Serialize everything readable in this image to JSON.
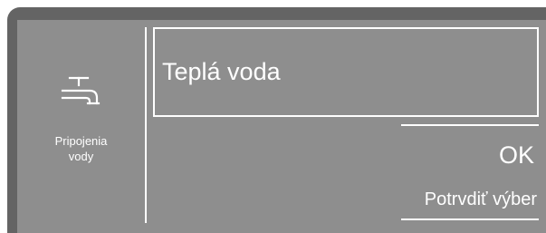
{
  "sidebar": {
    "item": {
      "icon": "water-tap-icon",
      "label_line1": "Pripojenia",
      "label_line2": "vody"
    }
  },
  "main": {
    "selected_option": "Teplá voda"
  },
  "actions": {
    "confirm_label": "OK",
    "confirm_sublabel": "Potrvdiť výber"
  },
  "colors": {
    "frame": "#646464",
    "panel": "#8e8e8e",
    "foreground": "#ffffff"
  }
}
